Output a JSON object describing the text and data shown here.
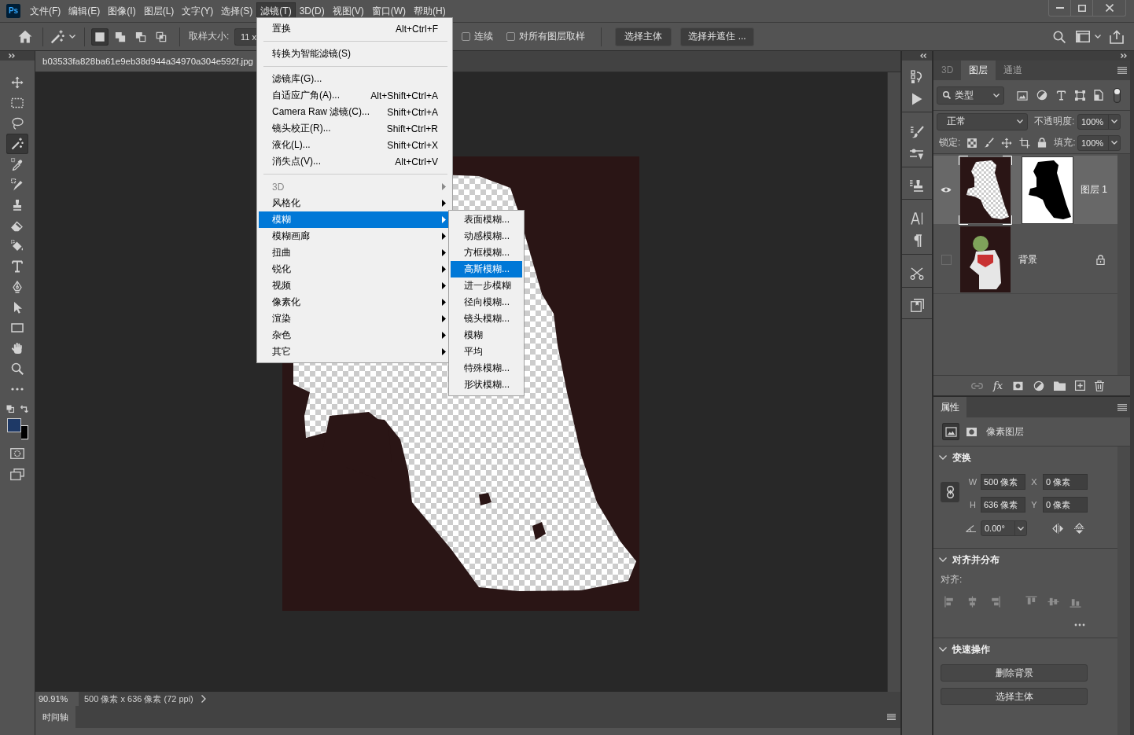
{
  "app_badge": "Ps",
  "menu_bar": {
    "items": [
      {
        "label": "文件(F)",
        "selected": false
      },
      {
        "label": "编辑(E)",
        "selected": false
      },
      {
        "label": "图像(I)",
        "selected": false
      },
      {
        "label": "图层(L)",
        "selected": false
      },
      {
        "label": "文字(Y)",
        "selected": false
      },
      {
        "label": "选择(S)",
        "selected": false
      },
      {
        "label": "滤镜(T)",
        "selected": true
      },
      {
        "label": "3D(D)",
        "selected": false
      },
      {
        "label": "视图(V)",
        "selected": false
      },
      {
        "label": "窗口(W)",
        "selected": false
      },
      {
        "label": "帮助(H)",
        "selected": false
      }
    ]
  },
  "filter_menu": {
    "groups": [
      {
        "items": [
          {
            "label": "置换",
            "shortcut": "Alt+Ctrl+F",
            "submenu": false,
            "disabled": false,
            "selected": false
          }
        ]
      },
      {
        "items": [
          {
            "label": "转换为智能滤镜(S)",
            "submenu": false,
            "disabled": false,
            "selected": false
          }
        ]
      },
      {
        "items": [
          {
            "label": "滤镜库(G)...",
            "submenu": false,
            "disabled": false,
            "selected": false
          },
          {
            "label": "自适应广角(A)...",
            "shortcut": "Alt+Shift+Ctrl+A",
            "submenu": false,
            "disabled": false,
            "selected": false
          },
          {
            "label": "Camera Raw 滤镜(C)...",
            "shortcut": "Shift+Ctrl+A",
            "submenu": false,
            "disabled": false,
            "selected": false
          },
          {
            "label": "镜头校正(R)...",
            "shortcut": "Shift+Ctrl+R",
            "submenu": false,
            "disabled": false,
            "selected": false
          },
          {
            "label": "液化(L)...",
            "shortcut": "Shift+Ctrl+X",
            "submenu": false,
            "disabled": false,
            "selected": false
          },
          {
            "label": "消失点(V)...",
            "shortcut": "Alt+Ctrl+V",
            "submenu": false,
            "disabled": false,
            "selected": false
          }
        ]
      },
      {
        "items": [
          {
            "label": "3D",
            "submenu": true,
            "disabled": true,
            "selected": false
          },
          {
            "label": "风格化",
            "submenu": true,
            "disabled": false,
            "selected": false
          },
          {
            "label": "模糊",
            "submenu": true,
            "disabled": false,
            "selected": true
          },
          {
            "label": "模糊画廊",
            "submenu": true,
            "disabled": false,
            "selected": false
          },
          {
            "label": "扭曲",
            "submenu": true,
            "disabled": false,
            "selected": false
          },
          {
            "label": "锐化",
            "submenu": true,
            "disabled": false,
            "selected": false
          },
          {
            "label": "视频",
            "submenu": true,
            "disabled": false,
            "selected": false
          },
          {
            "label": "像素化",
            "submenu": true,
            "disabled": false,
            "selected": false
          },
          {
            "label": "渲染",
            "submenu": true,
            "disabled": false,
            "selected": false
          },
          {
            "label": "杂色",
            "submenu": true,
            "disabled": false,
            "selected": false
          },
          {
            "label": "其它",
            "submenu": true,
            "disabled": false,
            "selected": false
          }
        ]
      }
    ]
  },
  "blur_submenu": {
    "items": [
      {
        "label": "表面模糊...",
        "selected": false
      },
      {
        "label": "动感模糊...",
        "selected": false
      },
      {
        "label": "方框模糊...",
        "selected": false
      },
      {
        "label": "高斯模糊...",
        "selected": true
      },
      {
        "label": "进一步模糊",
        "selected": false
      },
      {
        "label": "径向模糊...",
        "selected": false
      },
      {
        "label": "镜头模糊...",
        "selected": false
      },
      {
        "label": "模糊",
        "selected": false
      },
      {
        "label": "平均",
        "selected": false
      },
      {
        "label": "特殊模糊...",
        "selected": false
      },
      {
        "label": "形状模糊...",
        "selected": false
      }
    ]
  },
  "options_bar": {
    "selection_modes": [
      {
        "kind": "new",
        "selected": true
      },
      {
        "kind": "add",
        "selected": false
      },
      {
        "kind": "subtract",
        "selected": false
      },
      {
        "kind": "intersect",
        "selected": false
      }
    ],
    "sample_size_label": "取样大小:",
    "sample_size_value": "11 x",
    "checkboxes": [
      {
        "label": "连续",
        "checked": false
      },
      {
        "label": "对所有图层取样",
        "checked": false
      }
    ],
    "buttons": [
      "选择主体",
      "选择并遮住 ..."
    ]
  },
  "toolbar": {
    "tools": [
      {
        "kind": "move",
        "selected": false
      },
      {
        "kind": "marquee",
        "selected": false
      },
      {
        "kind": "lasso",
        "selected": false
      },
      {
        "kind": "wand",
        "selected": true
      },
      {
        "kind": "eyedropper",
        "selected": false
      },
      {
        "kind": "healing",
        "selected": false
      },
      {
        "kind": "stamp",
        "selected": false
      },
      {
        "kind": "eraser",
        "selected": false
      },
      {
        "kind": "bucket",
        "selected": false
      },
      {
        "kind": "type",
        "selected": false
      },
      {
        "kind": "pen",
        "selected": false
      },
      {
        "kind": "pointer",
        "selected": false
      },
      {
        "kind": "rectangle",
        "selected": false
      },
      {
        "kind": "hand",
        "selected": false
      },
      {
        "kind": "zoom",
        "selected": false
      },
      {
        "kind": "more",
        "selected": false
      }
    ],
    "colors": [
      {
        "kind": "foreground",
        "color": "#1e3966"
      },
      {
        "kind": "background",
        "color": "#000000"
      }
    ]
  },
  "document": {
    "tab_title": "b03533fa828ba61e9eb38d944a34970a304e592f.jpg",
    "zoom": "90.91%",
    "info": "500 像素 x 636 像素 (72 ppi)"
  },
  "timeline": {
    "tab": "时间轴"
  },
  "layers_panel": {
    "tabs": [
      {
        "label": "3D",
        "selected": false,
        "disabled": true
      },
      {
        "label": "图层",
        "selected": true,
        "disabled": false
      },
      {
        "label": "通道",
        "selected": false,
        "disabled": false
      }
    ],
    "filter_value": "类型",
    "filter_switch_on": true,
    "blend_mode": "正常",
    "opacity_label": "不透明度:",
    "opacity": "100%",
    "lock_label": "锁定:",
    "fill_label": "填充:",
    "fill": "100%",
    "effects_button": "fx",
    "layers": [
      {
        "name": "图层 1",
        "kind": "cutout",
        "visible": true,
        "selected": true,
        "has_mask": true,
        "locked": false
      },
      {
        "name": "背景",
        "kind": "photo",
        "visible": false,
        "selected": false,
        "has_mask": false,
        "locked": true
      }
    ]
  },
  "properties_panel": {
    "tab": "属性",
    "layer_type": "像素图层",
    "type_buttons": [
      {
        "kind": "pixel",
        "selected": true
      },
      {
        "kind": "mask",
        "selected": false
      }
    ],
    "transform": {
      "title": "变换",
      "expanded": true,
      "fields": [
        {
          "label": "W",
          "value": "500 像素"
        },
        {
          "label": "X",
          "value": "0 像素"
        },
        {
          "label": "H",
          "value": "636 像素"
        },
        {
          "label": "Y",
          "value": "0 像素"
        }
      ],
      "angle": "0.00°"
    },
    "align": {
      "title": "对齐并分布",
      "expanded": true,
      "label": "对齐:"
    },
    "quick_actions": {
      "title": "快速操作",
      "expanded": true,
      "buttons": [
        "删除背景",
        "选择主体"
      ]
    }
  }
}
